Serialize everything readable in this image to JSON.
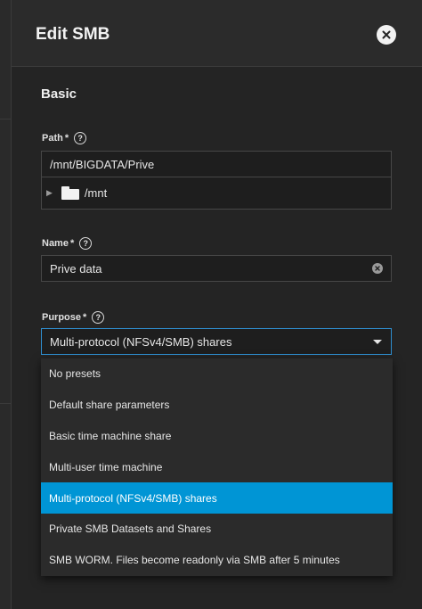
{
  "dialog": {
    "title": "Edit SMB"
  },
  "section": {
    "title": "Basic"
  },
  "path": {
    "label": "Path",
    "required": "*",
    "value": "/mnt/BIGDATA/Prive",
    "tree_item": "/mnt"
  },
  "name": {
    "label": "Name",
    "required": "*",
    "value": "Prive data"
  },
  "purpose": {
    "label": "Purpose",
    "required": "*",
    "selected": "Multi-protocol (NFSv4/SMB) shares",
    "options": [
      "No presets",
      "Default share parameters",
      "Basic time machine share",
      "Multi-user time machine",
      "Multi-protocol (NFSv4/SMB) shares",
      "Private SMB Datasets and Shares",
      "SMB WORM. Files become readonly via SMB after 5 minutes"
    ],
    "highlighted_index": 4
  },
  "icons": {
    "close": "close-icon",
    "help": "help-icon",
    "folder": "folder-icon",
    "expand": "expand-arrow-icon",
    "clear": "clear-icon",
    "dropdown": "chevron-down-icon"
  },
  "colors": {
    "accent": "#0095d5",
    "panel": "#242424",
    "header": "#2b2b2b"
  }
}
